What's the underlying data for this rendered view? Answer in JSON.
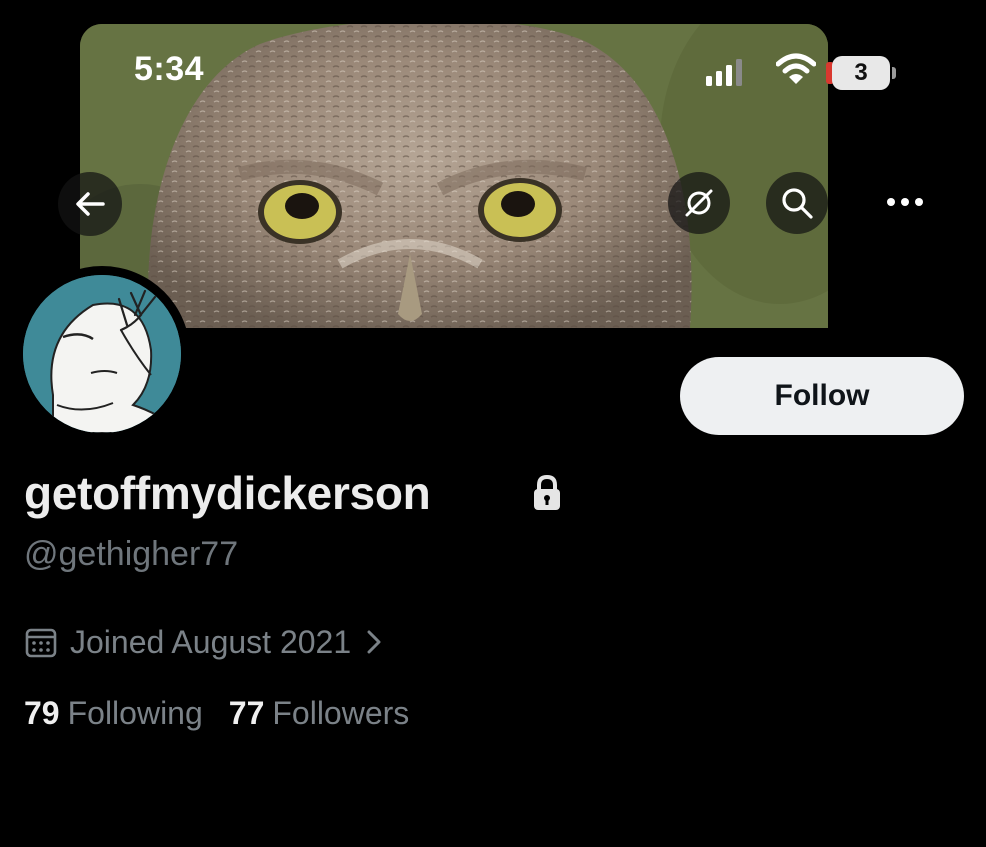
{
  "status_bar": {
    "time": "5:34",
    "battery_level": "3"
  },
  "header": {
    "banner_image": "owl-close-up",
    "back_icon": "arrow-left-icon",
    "mute_icon": "notifications-off-icon",
    "search_icon": "search-icon",
    "more_icon": "more-horizontal-icon"
  },
  "profile": {
    "avatar_image": "facepalm-drawing",
    "follow_label": "Follow",
    "display_name": "getoffmydickerson",
    "protected_icon": "lock-icon",
    "handle": "@gethigher77",
    "joined": "Joined August 2021",
    "following_count": "79",
    "following_label": "Following",
    "followers_count": "77",
    "followers_label": "Followers"
  },
  "colors": {
    "background": "#000000",
    "follow_button_bg": "#eef0f2",
    "secondary_text": "#7b8288",
    "primary_text": "#ececec"
  }
}
